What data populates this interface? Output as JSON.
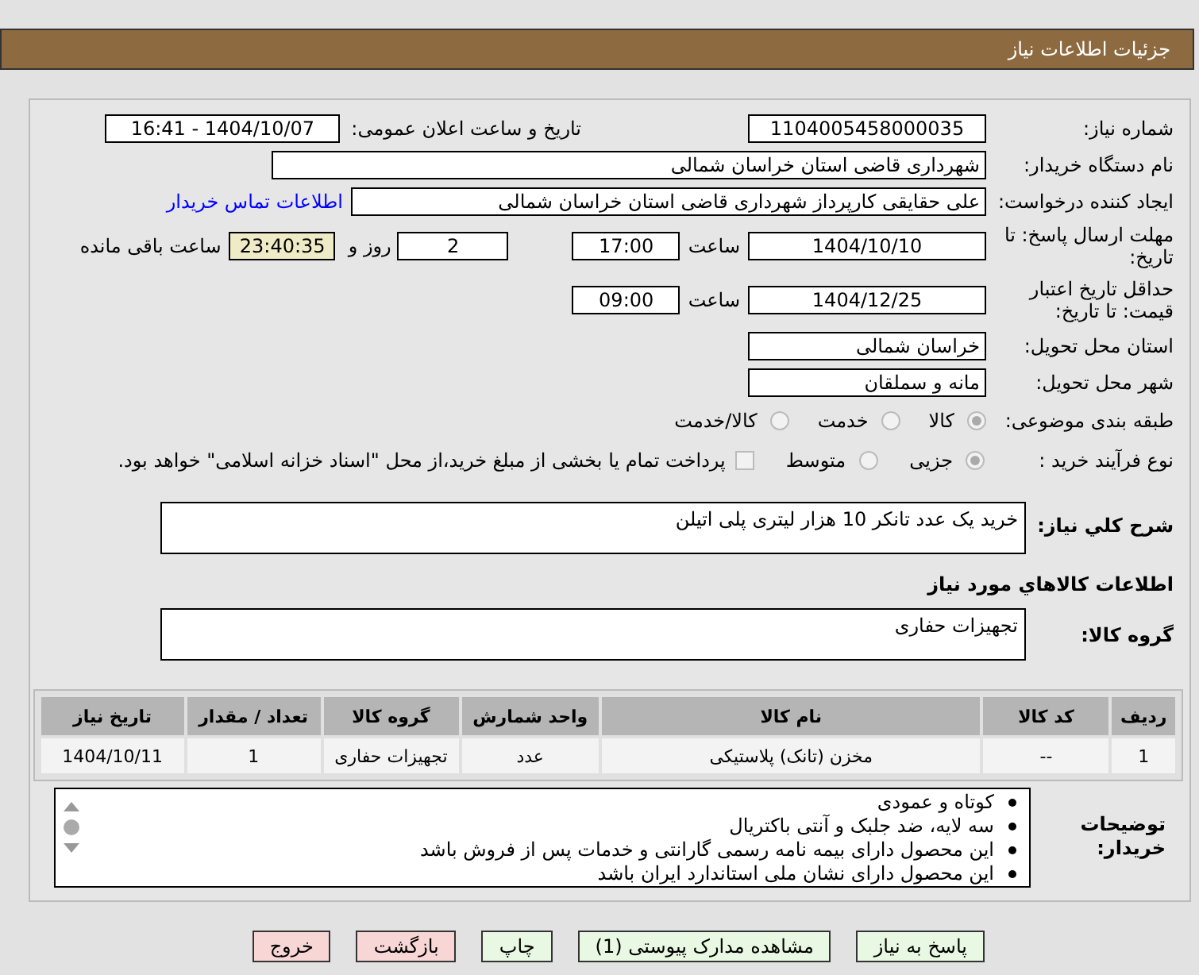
{
  "header": {
    "title": "جزئیات اطلاعات نیاز"
  },
  "need_number": {
    "label": "شماره نیاز:",
    "value": "1104005458000035"
  },
  "announce": {
    "label": "تاریخ و ساعت اعلان عمومی:",
    "value": "1404/10/07 - 16:41"
  },
  "buyer_org": {
    "label": "نام دستگاه خریدار:",
    "value": "شهرداری قاضی استان خراسان شمالی"
  },
  "requester": {
    "label": "ایجاد کننده درخواست:",
    "value": "علی  حقایقی  کارپرداز  شهرداری قاضی استان خراسان شمالی",
    "link": "اطلاعات تماس خریدار"
  },
  "reply_deadline": {
    "label": "مهلت ارسال پاسخ: تا تاریخ:",
    "date": "1404/10/10",
    "time_label": "ساعت",
    "time": "17:00",
    "days": "2",
    "days_label": "روز و",
    "remaining": "23:40:35",
    "remaining_label": "ساعت باقی مانده"
  },
  "price_validity": {
    "label": "حداقل تاریخ اعتبار قیمت: تا تاریخ:",
    "date": "1404/12/25",
    "time_label": "ساعت",
    "time": "09:00"
  },
  "province": {
    "label": "استان محل تحویل:",
    "value": "خراسان شمالی"
  },
  "city": {
    "label": "شهر محل تحویل:",
    "value": "مانه و سملقان"
  },
  "category": {
    "label": "طبقه بندی موضوعی:",
    "options": [
      {
        "label": "کالا",
        "selected": true
      },
      {
        "label": "خدمت",
        "selected": false
      },
      {
        "label": "کالا/خدمت",
        "selected": false
      }
    ]
  },
  "process": {
    "label": "نوع فرآیند خرید :",
    "options": [
      {
        "label": "جزیی",
        "selected": true
      },
      {
        "label": "متوسط",
        "selected": false
      }
    ],
    "treasury": {
      "checked": false,
      "label": "پرداخت تمام یا بخشی از مبلغ خرید،از محل \"اسناد خزانه اسلامی\" خواهد بود."
    }
  },
  "description": {
    "label": "شرح کلي نياز:",
    "value": "خرید یک عدد تانکر 10 هزار لیتری پلی اتیلن"
  },
  "goods_heading": "اطلاعات کالاهاي مورد نياز",
  "goods_group": {
    "label": "گروه کالا:",
    "value": "تجهیزات حفاری"
  },
  "table": {
    "columns": [
      "ردیف",
      "کد کالا",
      "نام کالا",
      "واحد شمارش",
      "گروه کالا",
      "تعداد / مقدار",
      "تاریخ نیاز"
    ],
    "rows": [
      [
        "1",
        "--",
        "مخزن (تانک) پلاستیکی",
        "عدد",
        "تجهیزات حفاری",
        "1",
        "1404/10/11"
      ]
    ]
  },
  "notes": {
    "label": "توضیحات خریدار:",
    "items": [
      "کوتاه و عمودی",
      "سه لایه، ضد جلبک و آنتی باکتریال",
      "این محصول دارای بیمه نامه رسمی گارانتی و خدمات پس از فروش باشد",
      "این محصول دارای نشان ملی استاندارد ایران باشد"
    ]
  },
  "buttons": [
    {
      "label": "پاسخ به نیاز",
      "kind": "action"
    },
    {
      "label": "مشاهده مدارک پیوستی (1)",
      "kind": "action"
    },
    {
      "label": "چاپ",
      "kind": "action"
    },
    {
      "label": "بازگشت",
      "kind": "cancel"
    },
    {
      "label": "خروج",
      "kind": "cancel"
    }
  ]
}
